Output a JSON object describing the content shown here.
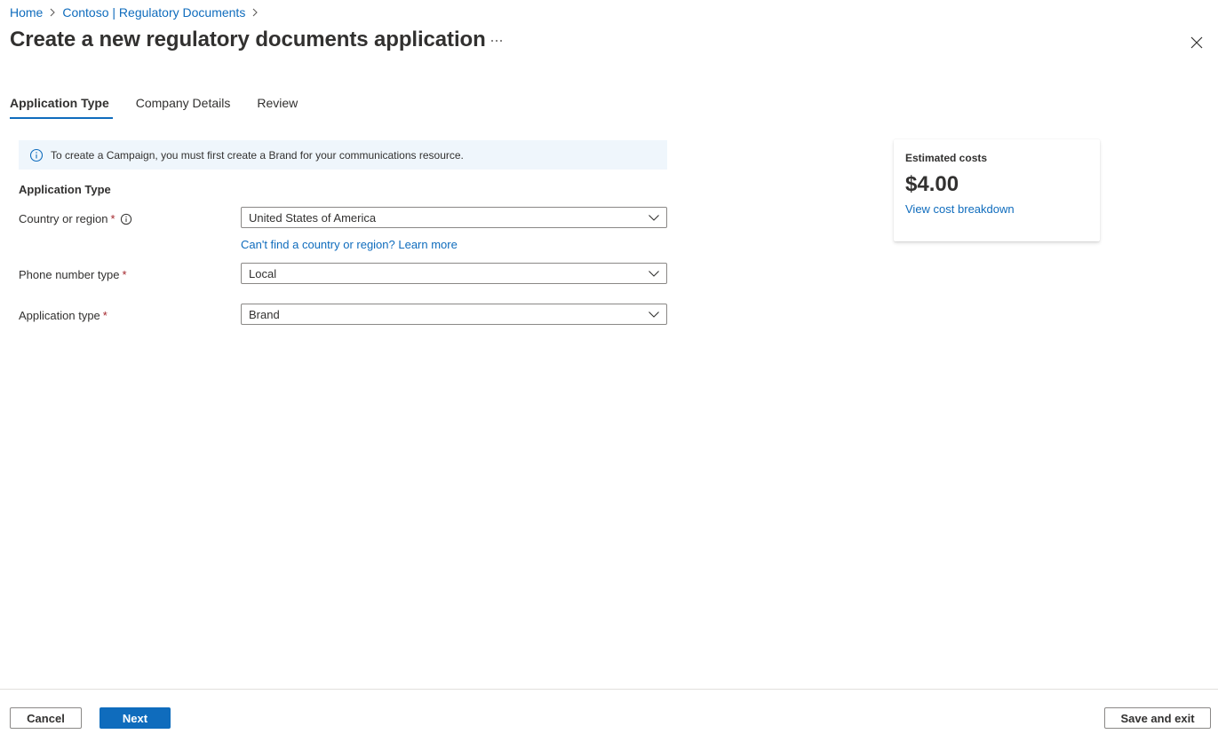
{
  "breadcrumb": {
    "home": "Home",
    "resource": "Contoso | Regulatory Documents"
  },
  "header": {
    "title": "Create a new regulatory documents application",
    "more": "···"
  },
  "tabs": [
    {
      "label": "Application Type",
      "active": true
    },
    {
      "label": "Company Details",
      "active": false
    },
    {
      "label": "Review",
      "active": false
    }
  ],
  "info_bar": {
    "text": "To create a Campaign, you must first create a Brand for your communications resource."
  },
  "form": {
    "section_title": "Application Type",
    "country": {
      "label": "Country or region",
      "required": "*",
      "value": "United States of America",
      "help_link": "Can't find a country or region? Learn more"
    },
    "phone_type": {
      "label": "Phone number type",
      "required": "*",
      "value": "Local"
    },
    "app_type": {
      "label": "Application type",
      "required": "*",
      "value": "Brand"
    }
  },
  "cost_card": {
    "title": "Estimated costs",
    "amount": "$4.00",
    "link": "View cost breakdown"
  },
  "footer": {
    "cancel": "Cancel",
    "next": "Next",
    "save_exit": "Save and exit"
  },
  "colors": {
    "accent": "#0f6cbd",
    "required": "#a4262c",
    "info_bg": "#eff6fc",
    "text": "#323130"
  },
  "icons": [
    "chevron-right-icon",
    "more-icon",
    "close-icon",
    "info-icon",
    "chevron-down-icon"
  ]
}
